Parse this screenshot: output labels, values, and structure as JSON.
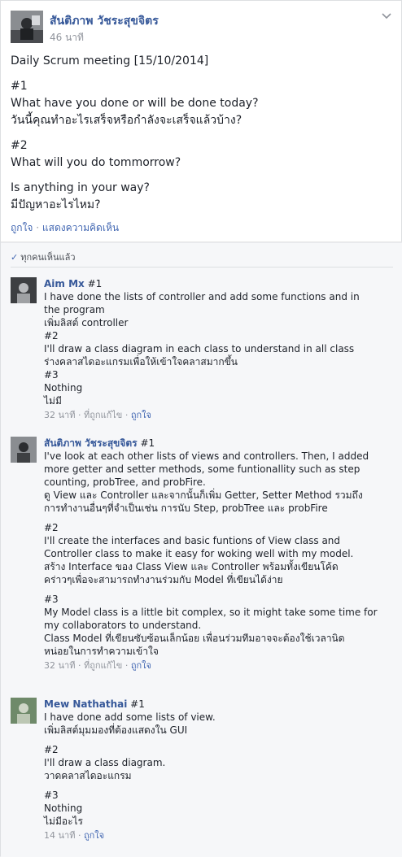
{
  "post": {
    "author": "สันติภาพ วัชระสุขจิตร",
    "time": "46 นาที",
    "body": [
      "Daily Scrum meeting [15/10/2014]",
      "",
      "#1",
      "What have you done or will be done today?",
      "วันนี้คุณทำอะไรเสร็จหรือกำลังจะเสร็จแล้วบ้าง?",
      "",
      "#2",
      "What will you do tommorrow?",
      "",
      "Is anything in your way?",
      "มีปัญหาอะไรไหม?"
    ],
    "like_label": "ถูกใจ",
    "comment_label": "แสดงความคิดเห็น"
  },
  "seen_label": "ทุกคนเห็นแล้ว",
  "comments": [
    {
      "name": "Aim Mx",
      "first_line": "#1",
      "lines": [
        "I have done the lists of controller and add some functions and in",
        "the program",
        "เพิ่มลิสต์ controller",
        "#2",
        "I'll draw a class diagram in each class to understand in all class",
        "ร่างคลาสไดอะแกรมเพื่อให้เข้าใจคลาสมากขึ้น",
        "#3",
        "Nothing",
        "ไม่มี"
      ],
      "time": "32 นาที",
      "edited": "ที่ถูกแก้ไข",
      "like": "ถูกใจ"
    },
    {
      "name": "สันติภาพ วัชระสุขจิตร",
      "first_line": "#1",
      "lines": [
        "I've look at each other lists of views and controllers. Then, I added",
        "more getter and setter methods, some funtionallity such as step",
        "counting, probTree, and probFire.",
        "ดู View และ Controller และจากนั้นก็เพิ่ม Getter, Setter Method รวมถึง",
        "การทำงานอื่นๆที่จำเป็นเช่น การนับ Step, probTree และ probFire",
        "",
        "#2",
        "I'll create the interfaces and basic funtions of View class and",
        "Controller class to make it easy for woking well with my model.",
        "สร้าง Interface ของ Class View และ Controller พร้อมทั้งเขียนโค้ด",
        "คร่าวๆเพื่อจะสามารถทำงานร่วมกับ Model ที่เขียนได้ง่าย",
        "",
        "#3",
        "My Model class is a little bit complex, so it might take some time for",
        "my collaborators to understand.",
        "Class Model ที่เขียนซับซ้อนเล็กน้อย เพื่อนร่วมทีมอาจจะต้องใช้เวลานิด",
        "หน่อยในการทำความเข้าใจ"
      ],
      "time": "32 นาที",
      "edited": "ที่ถูกแก้ไข",
      "like": "ถูกใจ"
    },
    {
      "name": "Mew Nathathai",
      "first_line": "#1",
      "lines": [
        "I have done add some lists of view.",
        "เพิ่มลิสต์มุมมองที่ต้องแสดงใน GUI",
        "",
        "#2",
        "I'll draw a class diagram.",
        "วาดคลาสไดอะแกรม",
        "",
        "#3",
        "Nothing",
        "ไม่มีอะไร"
      ],
      "time": "14 นาที",
      "edited": "",
      "like": "ถูกใจ"
    }
  ],
  "colors": {
    "name_blue": "#365899",
    "link_blue": "#4267b2",
    "meta_gray": "#90949c",
    "text": "#1d2129"
  },
  "icons": {
    "chevron": "chevron-down-icon",
    "check": "check-icon"
  }
}
